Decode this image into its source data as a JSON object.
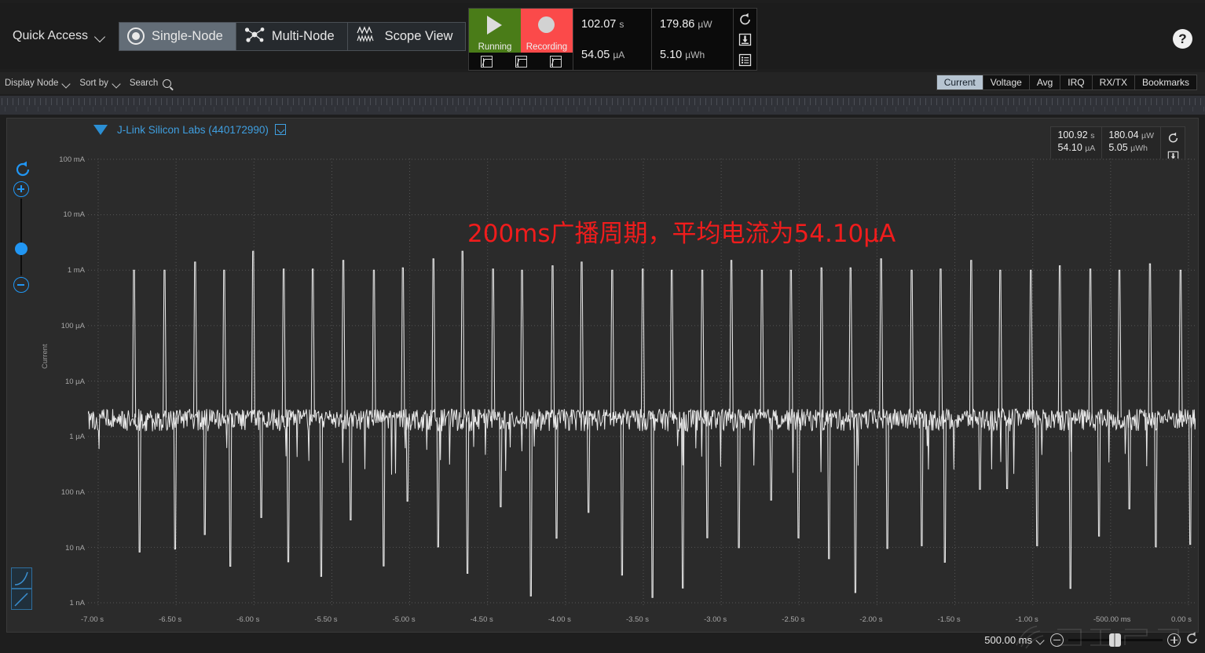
{
  "toolbar": {
    "quick_access": "Quick Access",
    "modes": [
      {
        "label": "Single-Node",
        "icon": "single-node-icon",
        "active": true
      },
      {
        "label": "Multi-Node",
        "icon": "multi-node-icon",
        "active": false
      },
      {
        "label": "Scope View",
        "icon": "scope-view-icon",
        "active": false
      }
    ],
    "run_label": "Running",
    "record_label": "Recording",
    "stats": {
      "elapsed": "102.07",
      "elapsed_unit": "s",
      "current": "54.05",
      "current_unit": "µA",
      "power": "179.86",
      "power_unit": "µW",
      "energy": "5.10",
      "energy_unit": "µWh"
    },
    "side_icons": [
      "reset-icon",
      "save-icon",
      "list-icon"
    ],
    "help": "?"
  },
  "subbar": {
    "display_node": "Display Node",
    "sort_by": "Sort by",
    "search": "Search"
  },
  "tabs": [
    {
      "label": "Current",
      "active": true
    },
    {
      "label": "Voltage",
      "active": false
    },
    {
      "label": "Avg",
      "active": false
    },
    {
      "label": "IRQ",
      "active": false
    },
    {
      "label": "RX/TX",
      "active": false
    },
    {
      "label": "Bookmarks",
      "active": false
    }
  ],
  "node": {
    "name": "J-Link Silicon Labs (440172990)",
    "readout": {
      "elapsed": "100.92",
      "elapsed_unit": "s",
      "current": "54.10",
      "current_unit": "µA",
      "power": "180.04",
      "power_unit": "µW",
      "energy": "5.05",
      "energy_unit": "µWh"
    }
  },
  "annotation": "200ms广播周期，平均电流为54.10μA",
  "zoom_bar": {
    "window": "500.00 ms"
  },
  "colors": {
    "accent_blue": "#2196f3",
    "node_blue": "#3f9fe0",
    "running_green": "#4a7c18",
    "recording_red": "#fb4a4a",
    "annotation_red": "#f01c1c",
    "trace_white": "#e8e8e8",
    "plot_bg": "#2b2b2b"
  },
  "chart_data": {
    "type": "line",
    "title": "Current",
    "xlabel": "",
    "ylabel": "Current",
    "x_unit": "s",
    "y_scale": "log",
    "grid": true,
    "legend": "none",
    "xlim": [
      -7.25,
      0.0
    ],
    "ylim": [
      1e-09,
      0.2
    ],
    "x_ticks": [
      "-7.00 s",
      "-6.50 s",
      "-6.00 s",
      "-5.50 s",
      "-5.00 s",
      "-4.50 s",
      "-4.00 s",
      "-3.50 s",
      "-3.00 s",
      "-2.50 s",
      "-2.00 s",
      "-1.50 s",
      "-1.00 s",
      "-500.00 ms",
      "0.00 s"
    ],
    "y_ticks": [
      "100 mA",
      "10 mA",
      "1 mA",
      "100 µA",
      "10 µA",
      "1 µA",
      "100 nA",
      "10 nA",
      "1 nA"
    ],
    "y_tick_values": [
      0.1,
      0.01,
      0.001,
      0.0001,
      1e-05,
      1e-06,
      1e-07,
      1e-08,
      1e-09
    ],
    "baseline_current_uA": 2.0,
    "average_current_uA": 54.1,
    "advertising_period_ms": 200,
    "peak_current_mA": 1.2,
    "series": [
      {
        "name": "Current",
        "color": "#e8e8e8",
        "description": "BLE advertising current trace: ~2 uA idle baseline with ~1 mA peaks every 200 ms",
        "peaks_s": [
          -6.95,
          -6.75,
          -6.55,
          -6.36,
          -6.17,
          -5.97,
          -5.78,
          -5.58,
          -5.38,
          -5.19,
          -4.99,
          -4.8,
          -4.6,
          -4.41,
          -4.21,
          -4.02,
          -3.82,
          -3.62,
          -3.43,
          -3.23,
          -3.04,
          -2.84,
          -2.65,
          -2.45,
          -2.26,
          -2.06,
          -1.86,
          -1.67,
          -1.47,
          -1.28,
          -1.08,
          -0.89,
          -0.69,
          -0.5,
          -0.3,
          -0.1
        ],
        "peak_values_mA": [
          1.0,
          1.0,
          1.4,
          1.0,
          2.2,
          1.05,
          1.05,
          1.5,
          1.0,
          1.1,
          1.6,
          2.2,
          1.05,
          1.0,
          1.2,
          1.4,
          1.0,
          1.05,
          1.0,
          1.0,
          1.5,
          1.0,
          1.0,
          1.1,
          1.1,
          1.6,
          1.0,
          1.05,
          1.5,
          1.0,
          1.0,
          1.2,
          1.05,
          1.0,
          1.3,
          1.0
        ]
      }
    ]
  }
}
